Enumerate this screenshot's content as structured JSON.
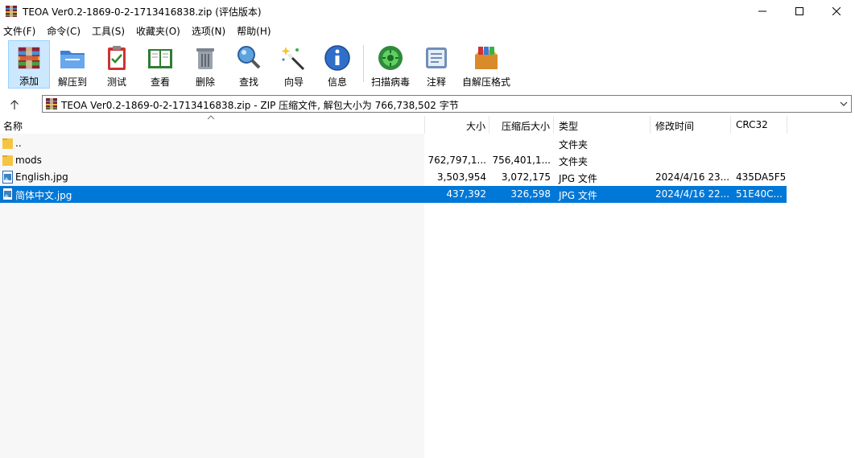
{
  "window": {
    "title": "TEOA Ver0.2-1869-0-2-1713416838.zip (评估版本)"
  },
  "menu": [
    "文件(F)",
    "命令(C)",
    "工具(S)",
    "收藏夹(O)",
    "选项(N)",
    "帮助(H)"
  ],
  "toolbar": [
    {
      "label": "添加",
      "icon": "add-archive-icon"
    },
    {
      "label": "解压到",
      "icon": "extract-to-icon"
    },
    {
      "label": "测试",
      "icon": "test-icon"
    },
    {
      "label": "查看",
      "icon": "view-icon"
    },
    {
      "label": "删除",
      "icon": "delete-icon"
    },
    {
      "label": "查找",
      "icon": "find-icon"
    },
    {
      "label": "向导",
      "icon": "wizard-icon"
    },
    {
      "label": "信息",
      "icon": "info-icon"
    },
    {
      "label": "扫描病毒",
      "icon": "virus-scan-icon"
    },
    {
      "label": "注释",
      "icon": "comment-icon"
    },
    {
      "label": "自解压格式",
      "icon": "sfx-icon"
    }
  ],
  "address": {
    "text": "TEOA Ver0.2-1869-0-2-1713416838.zip - ZIP 压缩文件, 解包大小为 766,738,502 字节"
  },
  "columns": [
    "名称",
    "大小",
    "压缩后大小",
    "类型",
    "修改时间",
    "CRC32"
  ],
  "files": [
    {
      "name": "..",
      "size": "",
      "packed": "",
      "type": "文件夹",
      "modified": "",
      "crc": "",
      "icon": "folder-icon"
    },
    {
      "name": "mods",
      "size": "762,797,1...",
      "packed": "756,401,1...",
      "type": "文件夹",
      "modified": "",
      "crc": "",
      "icon": "folder-icon"
    },
    {
      "name": "English.jpg",
      "size": "3,503,954",
      "packed": "3,072,175",
      "type": "JPG 文件",
      "modified": "2024/4/16 23...",
      "crc": "435DA5F5",
      "icon": "image-file-icon"
    },
    {
      "name": "简体中文.jpg",
      "size": "437,392",
      "packed": "326,598",
      "type": "JPG 文件",
      "modified": "2024/4/16 22...",
      "crc": "51E40C...",
      "icon": "image-file-icon",
      "selected": true
    }
  ],
  "colors": {
    "selection": "#0078d7",
    "toolbar_active": "#cce8ff"
  }
}
